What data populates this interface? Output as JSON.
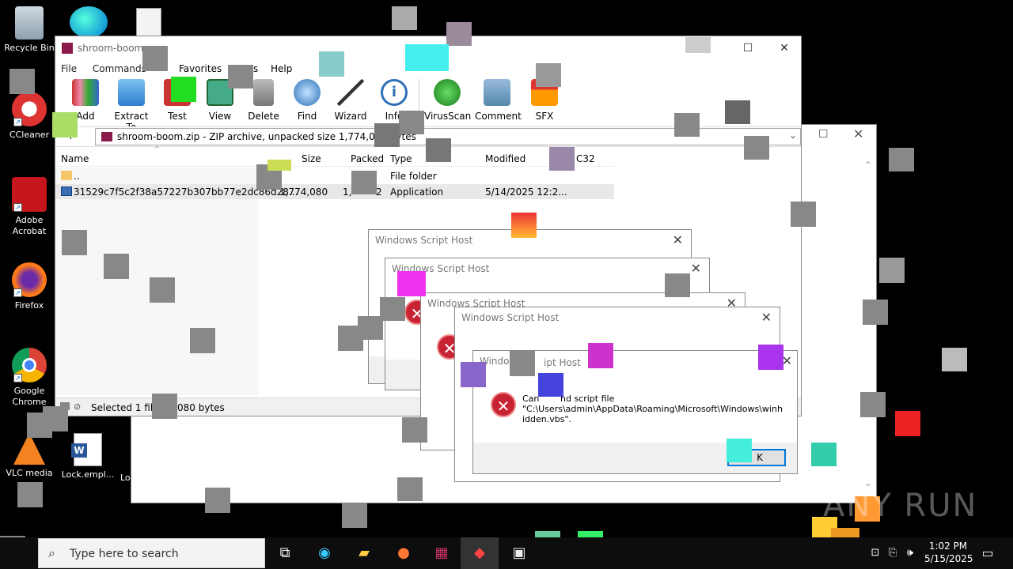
{
  "desktop": {
    "icons": [
      {
        "label": "Recycle Bin"
      },
      {
        "label": "CCleaner"
      },
      {
        "label": "Adobe Acrobat"
      },
      {
        "label": "Firefox"
      },
      {
        "label": "Google Chrome"
      },
      {
        "label": "VLC media"
      },
      {
        "label": "Lock.empl..."
      },
      {
        "label": "Lo"
      }
    ]
  },
  "winrar": {
    "title": "shroom-boom.",
    "menu": [
      "File",
      "Commands",
      "Favorites",
      "O",
      "s",
      "Help"
    ],
    "toolbar": [
      "Add",
      "Extract To",
      "Test",
      "View",
      "Delete",
      "Find",
      "Wizard",
      "Info",
      "VirusScan",
      "Comment",
      "SFX"
    ],
    "path": "shroom-boom.zip - ZIP archive, unpacked size 1,774,080 bytes",
    "columns": [
      "Name",
      "Size",
      "Packed",
      "Type",
      "Modified",
      "C32"
    ],
    "rows": [
      {
        "name": "..",
        "size": "",
        "packed": "",
        "type": "File folder",
        "modified": ""
      },
      {
        "name": "31529c7f5c2f38a57227b307bb77e2dc86d28...",
        "size": "1,774,080",
        "packed": "1,",
        "packed2": "2",
        "type": "Application",
        "modified": "5/14/2025 12:2..."
      }
    ],
    "status_left": "Selected 1 file,",
    "status_right": "080 bytes"
  },
  "dialogs": [
    {
      "title": "Windows Script Host"
    },
    {
      "title": "Windows Script Host"
    },
    {
      "title": "Windows Script Host"
    },
    {
      "title": "Windows Script Host"
    },
    {
      "title": "Windows Script Host",
      "title_a": "Windo",
      "title_b": "ipt Host"
    }
  ],
  "message": {
    "prefix": "Can",
    "suffix": "nd script file",
    "path_line1": "\"C:\\Users\\admin\\AppData\\Roaming\\Microsoft\\Windows\\winh",
    "path_line2": "idden.vbs\".",
    "ok": "OK",
    "ok_partial": "K"
  },
  "taskbar": {
    "search_placeholder": "Type here to search",
    "time": "1:02 PM",
    "date": "5/15/2025"
  },
  "watermark": "ANY RUN"
}
